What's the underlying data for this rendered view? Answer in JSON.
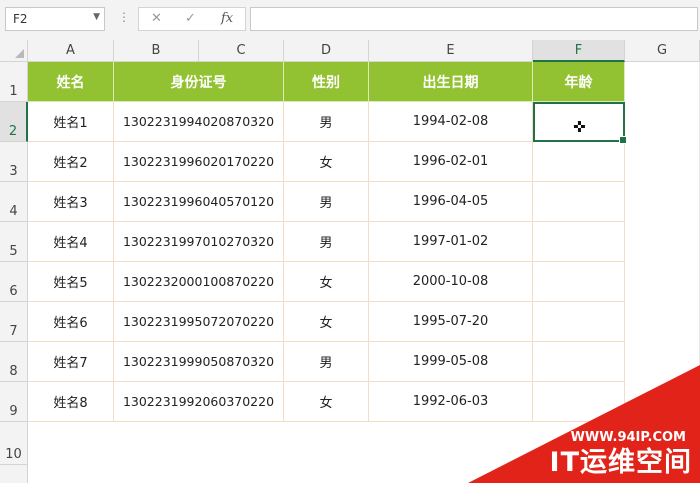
{
  "formula_bar": {
    "name_box": "F2",
    "dots": "⋮",
    "cancel_symbol": "✕",
    "enter_symbol": "✓",
    "fx_symbol": "fx",
    "formula": ""
  },
  "columns": [
    "A",
    "B",
    "C",
    "D",
    "E",
    "F",
    "G"
  ],
  "rows": [
    "1",
    "2",
    "3",
    "4",
    "5",
    "6",
    "7",
    "8",
    "9",
    "10"
  ],
  "table": {
    "headers": [
      "姓名",
      "身份证号",
      "性别",
      "出生日期",
      "年龄"
    ],
    "records": [
      {
        "name": "姓名1",
        "id": "130223199402087032​0",
        "gender": "男",
        "birth": "1994-02-08",
        "age": ""
      },
      {
        "name": "姓名2",
        "id": "130223199602017022​0",
        "gender": "女",
        "birth": "1996-02-01",
        "age": ""
      },
      {
        "name": "姓名3",
        "id": "130223199604057012​0",
        "gender": "男",
        "birth": "1996-04-05",
        "age": ""
      },
      {
        "name": "姓名4",
        "id": "130223199701027032​0",
        "gender": "男",
        "birth": "1997-01-02",
        "age": ""
      },
      {
        "name": "姓名5",
        "id": "130223200010087022​0",
        "gender": "女",
        "birth": "2000-10-08",
        "age": ""
      },
      {
        "name": "姓名6",
        "id": "130223199507207022​0",
        "gender": "女",
        "birth": "1995-07-20",
        "age": ""
      },
      {
        "name": "姓名7",
        "id": "130223199905087032​0",
        "gender": "男",
        "birth": "1999-05-08",
        "age": ""
      },
      {
        "name": "姓名8",
        "id": "130223199206037022​0",
        "gender": "女",
        "birth": "1992-06-03",
        "age": ""
      }
    ]
  },
  "selected_cell": "F2",
  "watermark": {
    "url": "WWW.94IP.COM",
    "name": "IT运维空间"
  },
  "colors": {
    "header_green": "#92c131",
    "selection_green": "#217346",
    "watermark_red": "#e2231a"
  }
}
